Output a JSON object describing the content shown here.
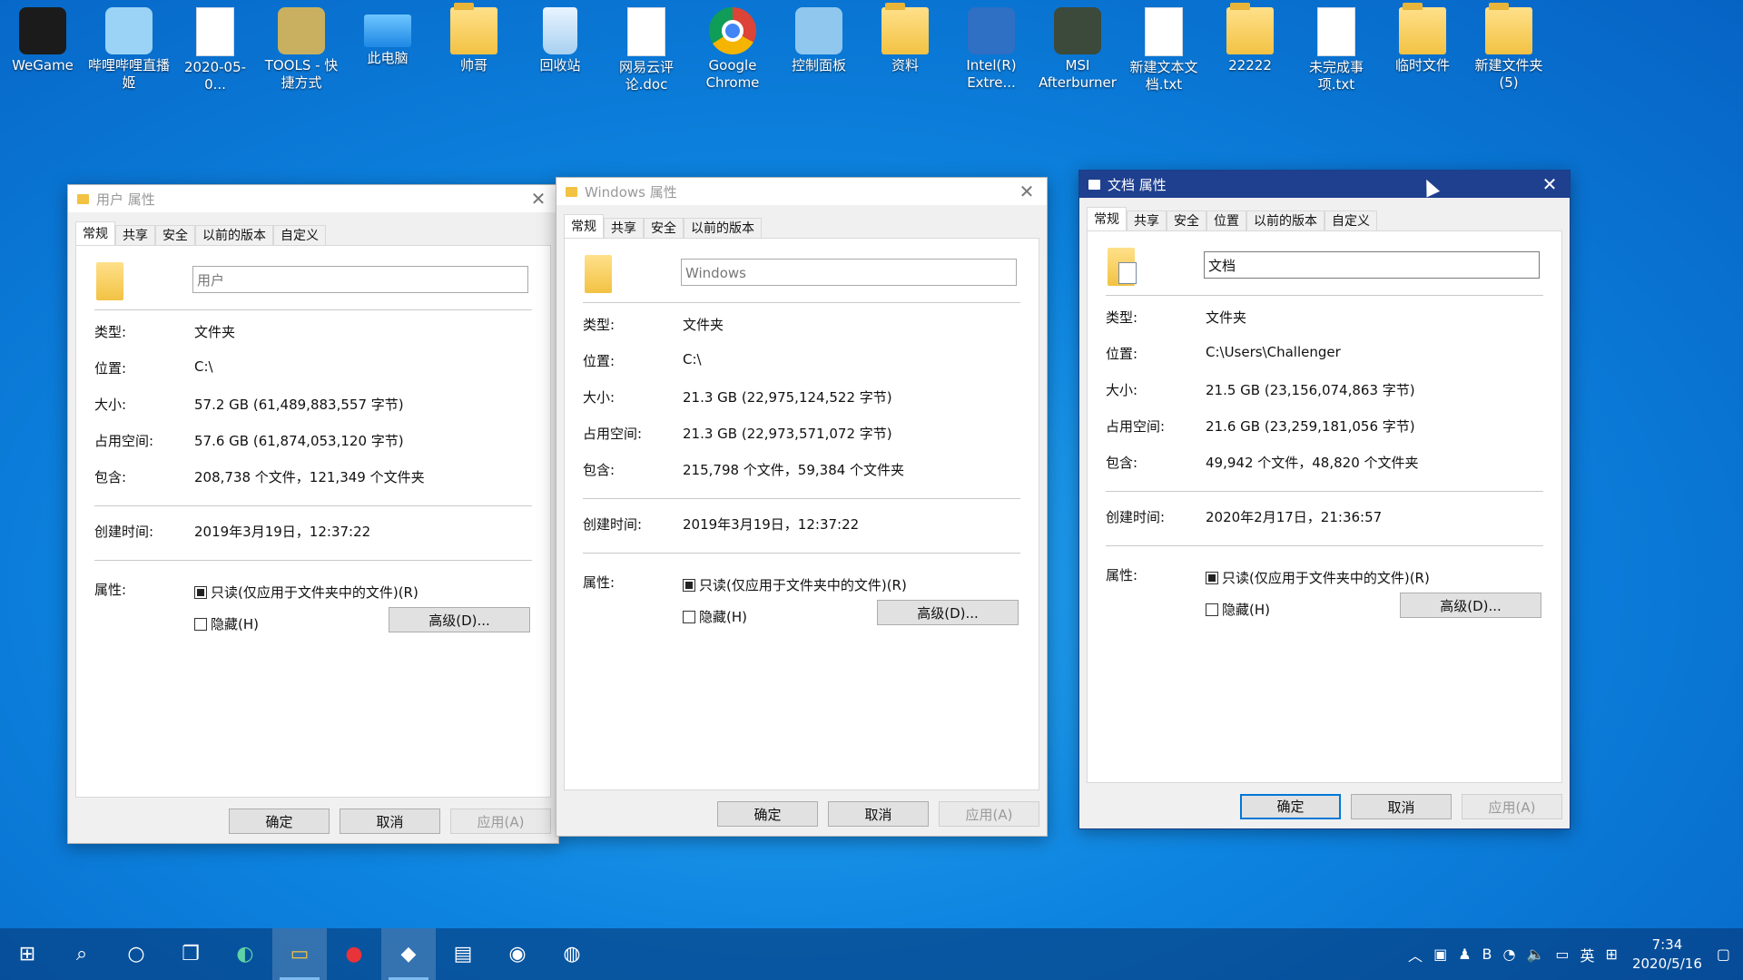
{
  "desktop_icons": [
    {
      "label": "WeGame",
      "icon": "wegame-icon"
    },
    {
      "label": "哔哩哔哩直播姬",
      "icon": "bilibili-live-icon"
    },
    {
      "label": "2020-05-0...",
      "icon": "file-icon"
    },
    {
      "label": "TOOLS - 快捷方式",
      "icon": "shortcut-icon"
    },
    {
      "label": "此电脑",
      "icon": "this-pc-icon"
    },
    {
      "label": "帅哥",
      "icon": "user-folder-icon"
    },
    {
      "label": "回收站",
      "icon": "recycle-bin-icon"
    },
    {
      "label": "网易云评论.doc",
      "icon": "word-doc-icon"
    },
    {
      "label": "Google Chrome",
      "icon": "chrome-icon"
    },
    {
      "label": "控制面板",
      "icon": "control-panel-icon"
    },
    {
      "label": "资料",
      "icon": "folder-icon"
    },
    {
      "label": "Intel(R) Extre...",
      "icon": "intel-icon"
    },
    {
      "label": "MSI Afterburner",
      "icon": "msi-afterburner-icon"
    },
    {
      "label": "新建文本文档.txt",
      "icon": "text-file-icon"
    },
    {
      "label": "22222",
      "icon": "folder-icon"
    },
    {
      "label": "未完成事项.txt",
      "icon": "text-file-icon"
    },
    {
      "label": "临时文件",
      "icon": "folder-icon"
    },
    {
      "label": "新建文件夹 (5)",
      "icon": "folder-icon"
    }
  ],
  "windows": [
    {
      "title": "用户 属性",
      "tabs": [
        "常规",
        "共享",
        "安全",
        "以前的版本",
        "自定义"
      ],
      "name": "用户",
      "rows": {
        "type_label": "类型:",
        "type": "文件夹",
        "loc_label": "位置:",
        "location": "C:\\",
        "size_label": "大小:",
        "size": "57.2 GB (61,489,883,557 字节)",
        "disk_label": "占用空间:",
        "disk": "57.6 GB (61,874,053,120 字节)",
        "contains_label": "包含:",
        "contains": "208,738 个文件，121,349 个文件夹",
        "created_label": "创建时间:",
        "created": "2019年3月19日，12:37:22",
        "attr_label": "属性:"
      },
      "readonly": "只读(仅应用于文件夹中的文件)(R)",
      "hidden": "隐藏(H)",
      "advanced": "高级(D)...",
      "ok": "确定",
      "cancel": "取消",
      "apply": "应用(A)"
    },
    {
      "title": "Windows 属性",
      "tabs": [
        "常规",
        "共享",
        "安全",
        "以前的版本"
      ],
      "name": "Windows",
      "rows": {
        "type_label": "类型:",
        "type": "文件夹",
        "loc_label": "位置:",
        "location": "C:\\",
        "size_label": "大小:",
        "size": "21.3 GB (22,975,124,522 字节)",
        "disk_label": "占用空间:",
        "disk": "21.3 GB (22,973,571,072 字节)",
        "contains_label": "包含:",
        "contains": "215,798 个文件，59,384 个文件夹",
        "created_label": "创建时间:",
        "created": "2019年3月19日，12:37:22",
        "attr_label": "属性:"
      },
      "readonly": "只读(仅应用于文件夹中的文件)(R)",
      "hidden": "隐藏(H)",
      "advanced": "高级(D)...",
      "ok": "确定",
      "cancel": "取消",
      "apply": "应用(A)"
    },
    {
      "title": "文档 属性",
      "tabs": [
        "常规",
        "共享",
        "安全",
        "位置",
        "以前的版本",
        "自定义"
      ],
      "name": "文档",
      "rows": {
        "type_label": "类型:",
        "type": "文件夹",
        "loc_label": "位置:",
        "location": "C:\\Users\\Challenger",
        "size_label": "大小:",
        "size": "21.5 GB (23,156,074,863 字节)",
        "disk_label": "占用空间:",
        "disk": "21.6 GB (23,259,181,056 字节)",
        "contains_label": "包含:",
        "contains": "49,942 个文件，48,820 个文件夹",
        "created_label": "创建时间:",
        "created": "2020年2月17日，21:36:57",
        "attr_label": "属性:"
      },
      "readonly": "只读(仅应用于文件夹中的文件)(R)",
      "hidden": "隐藏(H)",
      "advanced": "高级(D)...",
      "ok": "确定",
      "cancel": "取消",
      "apply": "应用(A)"
    }
  ],
  "taskbar": {
    "items": [
      "start-icon",
      "search-icon",
      "cortana-icon",
      "task-view-icon",
      "edge-icon",
      "file-explorer-icon",
      "netease-music-icon",
      "qq-icon",
      "vmware-icon",
      "steam-icon",
      "obs-icon"
    ],
    "tray": {
      "ime": "英",
      "time": "7:34",
      "date": "2020/5/16"
    }
  },
  "colors": {
    "active_titlebar": "#1f3f8f",
    "accent": "#0078d7"
  }
}
